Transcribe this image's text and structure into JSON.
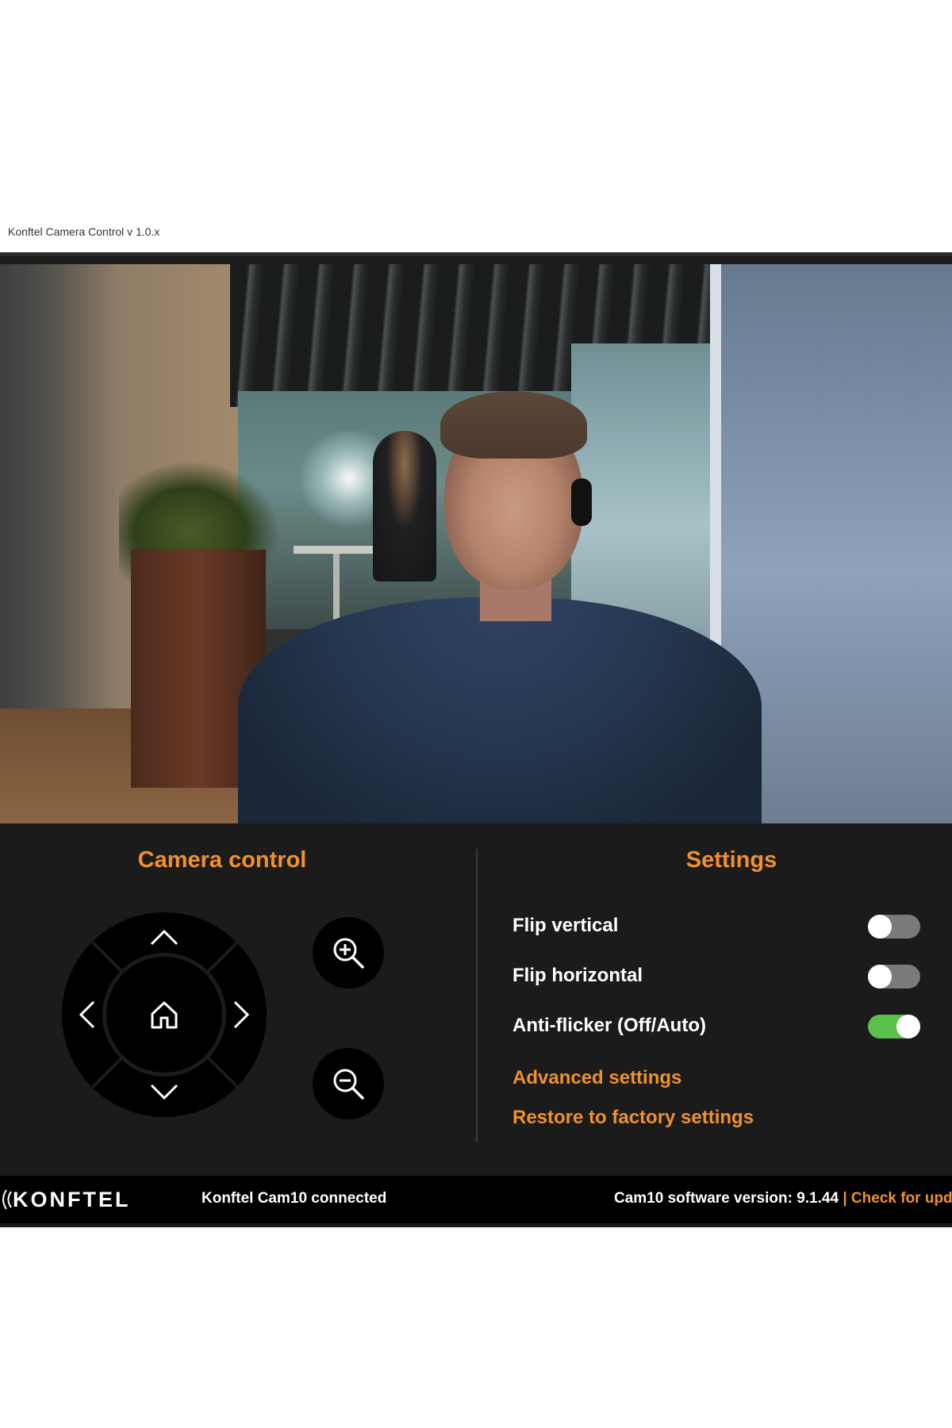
{
  "window": {
    "title": "Konftel Camera Control v 1.0.x"
  },
  "camera_control": {
    "title": "Camera control",
    "buttons": {
      "up_icon": "chevron-up-icon",
      "down_icon": "chevron-down-icon",
      "left_icon": "chevron-left-icon",
      "right_icon": "chevron-right-icon",
      "home_icon": "home-icon",
      "zoom_in_icon": "zoom-in-icon",
      "zoom_out_icon": "zoom-out-icon"
    }
  },
  "settings": {
    "title": "Settings",
    "toggles": [
      {
        "label": "Flip vertical",
        "on": false
      },
      {
        "label": "Flip horizontal",
        "on": false
      },
      {
        "label": "Anti-flicker (Off/Auto)",
        "on": true
      }
    ],
    "links": {
      "advanced": "Advanced settings",
      "restore": "Restore to factory settings"
    }
  },
  "footer": {
    "logo": "KONFTEL",
    "status": "Konftel Cam10 connected",
    "version": "Cam10 software version: 9.1.44",
    "separator": "|",
    "update_link": "Check for updates"
  },
  "colors": {
    "accent": "#f0912d",
    "panel_bg": "#1b1b1b",
    "toggle_on": "#5cc14b",
    "toggle_off": "#7a7a7a"
  }
}
